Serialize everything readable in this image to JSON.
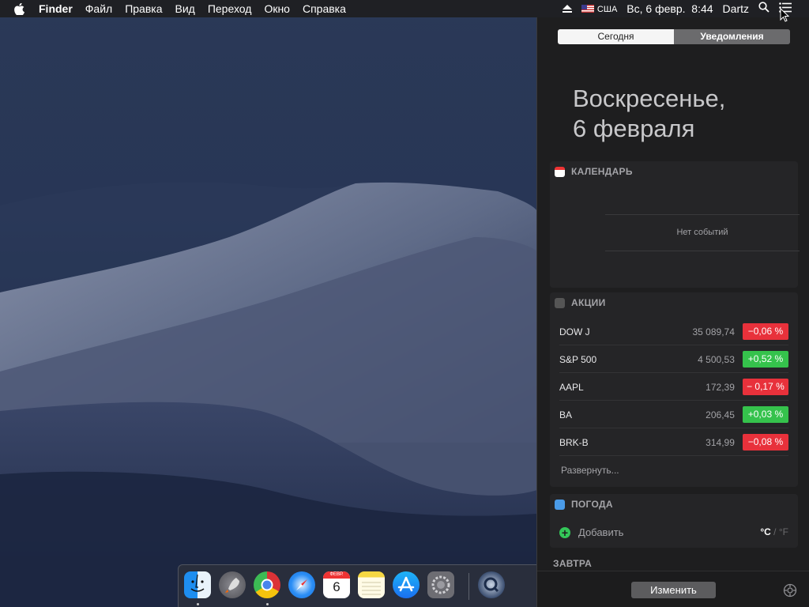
{
  "menubar": {
    "app_name": "Finder",
    "menus": [
      "Файл",
      "Правка",
      "Вид",
      "Переход",
      "Окно",
      "Справка"
    ],
    "input_source": "США",
    "datetime": "Вс, 6 февр.  8:44",
    "user": "Dartz"
  },
  "notification_center": {
    "tabs": [
      "Сегодня",
      "Уведомления"
    ],
    "active_tab": "Сегодня",
    "date_line1": "Воскресенье,",
    "date_line2": "6 февраля",
    "calendar": {
      "title": "КАЛЕНДАРЬ",
      "empty_text": "Нет событий"
    },
    "stocks": {
      "title": "АКЦИИ",
      "rows": [
        {
          "symbol": "DOW J",
          "price": "35 089,74",
          "change": "−0,06 %",
          "direction": "down"
        },
        {
          "symbol": "S&P 500",
          "price": "4 500,53",
          "change": "+0,52 %",
          "direction": "up"
        },
        {
          "symbol": "AAPL",
          "price": "172,39",
          "change": "− 0,17 %",
          "direction": "down"
        },
        {
          "symbol": "BA",
          "price": "206,45",
          "change": "+0,03 %",
          "direction": "up"
        },
        {
          "symbol": "BRK-B",
          "price": "314,99",
          "change": "−0,08 %",
          "direction": "down"
        }
      ],
      "expand_label": "Развернуть..."
    },
    "weather": {
      "title": "ПОГОДА",
      "add_label": "Добавить",
      "unit_c": "°C",
      "unit_sep": "/",
      "unit_f": "°F"
    },
    "tomorrow_label": "ЗАВТРА",
    "edit_button": "Изменить"
  },
  "dock": {
    "apps": [
      "finder-icon",
      "launchpad-icon",
      "chrome-icon",
      "safari-icon",
      "calendar-icon",
      "notes-icon",
      "app-store-icon",
      "system-preferences-icon",
      "quicktime-icon"
    ],
    "calendar_month": "ФЕВР.",
    "calendar_day": "6"
  },
  "colors": {
    "negative": "#e8313b",
    "positive": "#35c24c"
  }
}
